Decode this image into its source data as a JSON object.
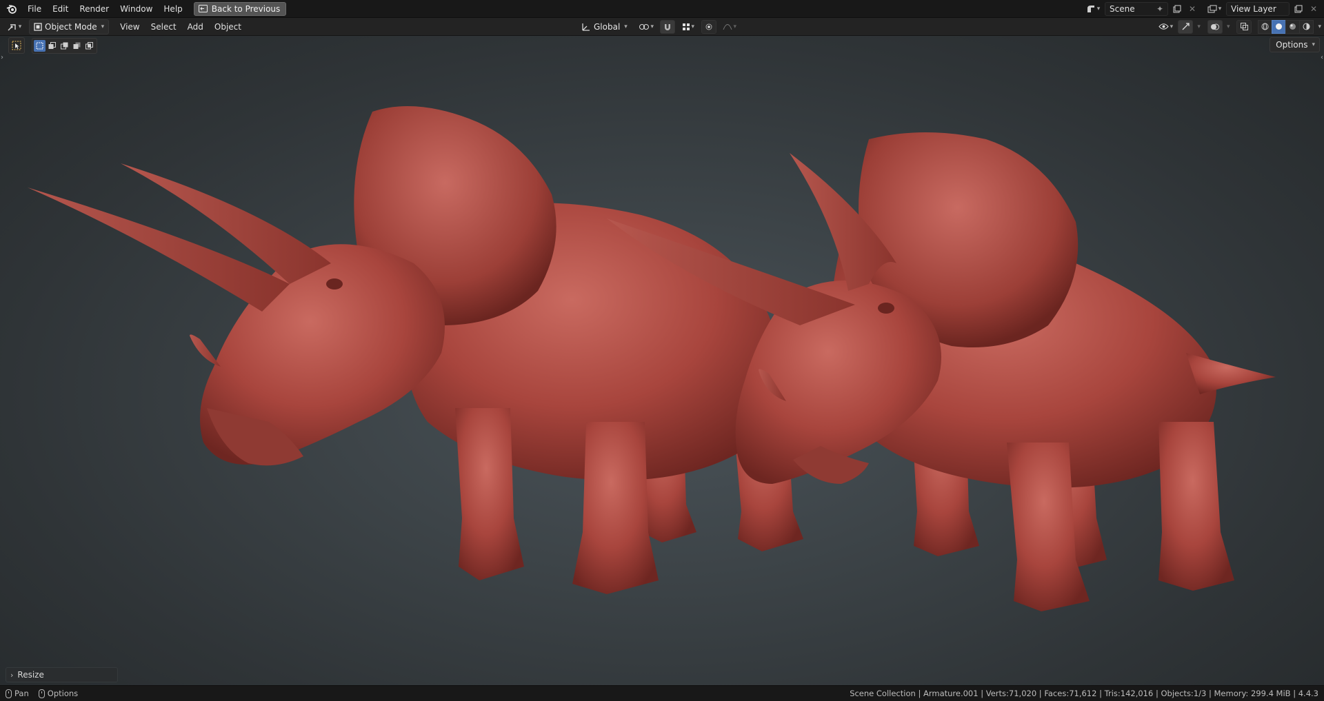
{
  "topbar": {
    "menus": [
      "File",
      "Edit",
      "Render",
      "Window",
      "Help"
    ],
    "back_button": "Back to Previous",
    "scene_name": "Scene",
    "view_layer": "View Layer"
  },
  "header": {
    "mode": "Object Mode",
    "menus": [
      "View",
      "Select",
      "Add",
      "Object"
    ],
    "transform_orientation": "Global"
  },
  "viewport": {
    "options_label": "Options",
    "last_operator": "Resize",
    "icons": {
      "select_tool": "select-box-tool-icon",
      "pivot": "transform-pivot-icon",
      "snap": "snap-magnet-icon",
      "proportional": "proportional-editing-icon",
      "overlay": "overlays-icon",
      "xray": "xray-icon",
      "shading": [
        "wireframe-shading-icon",
        "solid-shading-icon",
        "material-preview-icon",
        "rendered-shading-icon"
      ]
    },
    "colors": {
      "accent": "#4772b3",
      "model": "#b54e45"
    }
  },
  "statusbar": {
    "hint_pan": "Pan",
    "hint_options": "Options",
    "stats": "Scene Collection | Armature.001 | Verts:71,020 | Faces:71,612 | Tris:142,016 | Objects:1/3 | Memory: 299.4 MiB | 4.4.3"
  }
}
